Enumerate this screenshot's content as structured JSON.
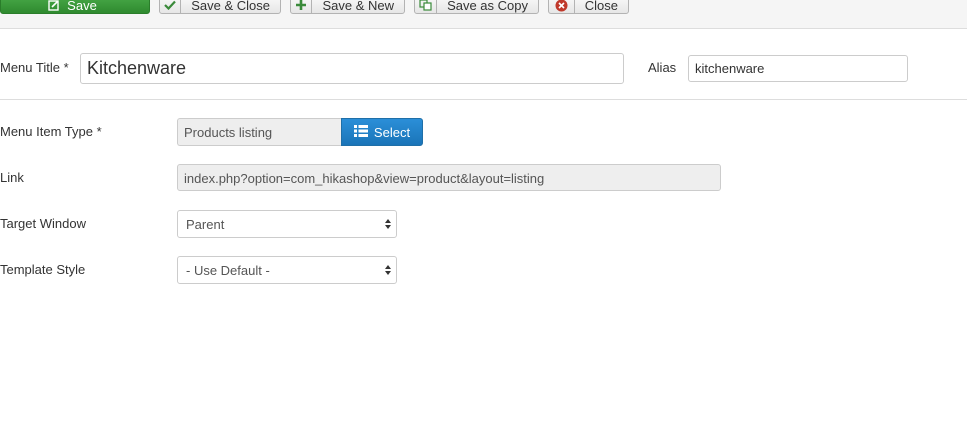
{
  "toolbar": {
    "save_label": "Save",
    "save_close_label": "Save & Close",
    "save_new_label": "Save & New",
    "save_copy_label": "Save as Copy",
    "close_label": "Close",
    "icons": {
      "save": "edit-icon",
      "save_close": "check-icon",
      "save_new": "plus-icon",
      "save_copy": "copy-icon",
      "close": "close-circle-icon"
    },
    "colors": {
      "save_bg": "#3d9c3d",
      "check": "#3a8a3a",
      "plus": "#3a8a3a",
      "copy": "#3a8a3a",
      "close": "#c0392b"
    }
  },
  "form": {
    "title_label": "Menu Title *",
    "title_value": "Kitchenware",
    "alias_label": "Alias",
    "alias_value": "kitchenware",
    "menu_item_type_label": "Menu Item Type *",
    "menu_item_type_value": "Products listing",
    "select_button_label": "Select",
    "link_label": "Link",
    "link_value": "index.php?option=com_hikashop&view=product&layout=listing",
    "target_window_label": "Target Window",
    "target_window_value": "Parent",
    "template_style_label": "Template Style",
    "template_style_value": "- Use Default -"
  },
  "colors": {
    "accent_blue": "#1a74b8",
    "field_readonly_bg": "#eeeeee",
    "border": "#cccccc"
  }
}
